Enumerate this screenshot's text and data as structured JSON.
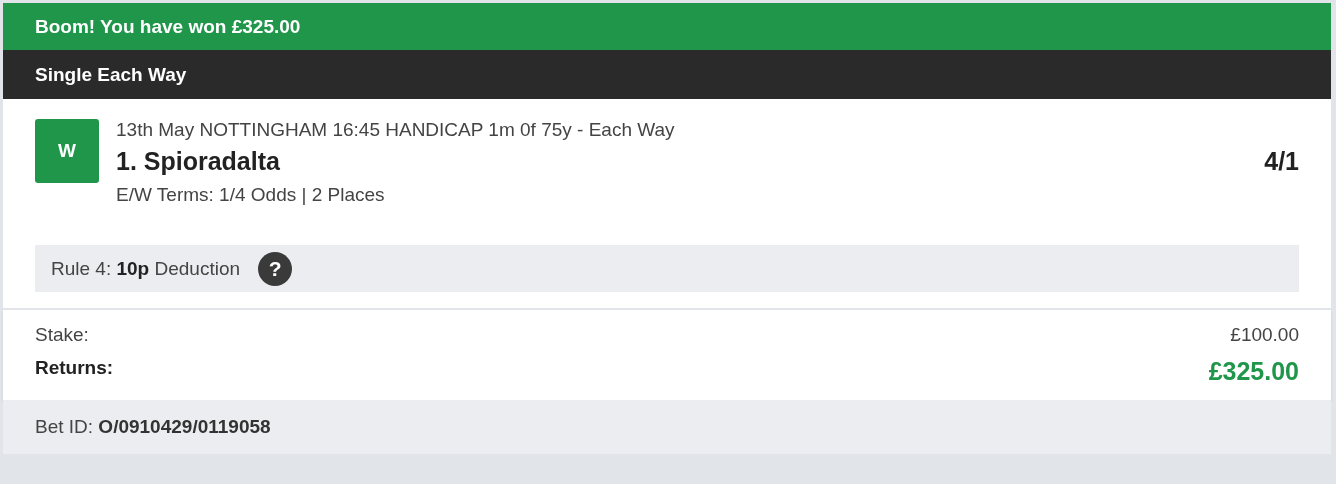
{
  "banner": {
    "text": "Boom! You have won £325.00"
  },
  "bet_type": "Single Each Way",
  "selection": {
    "result": "W",
    "event": "13th May NOTTINGHAM 16:45 HANDICAP 1m 0f 75y - Each Way",
    "runner": "1. Spioradalta",
    "odds": "4/1",
    "terms": "E/W Terms: 1/4 Odds | 2 Places"
  },
  "rule4": {
    "text": "Rule 4: **10p** Deduction",
    "help_icon": "?"
  },
  "totals": [
    {
      "label": "Stake:",
      "value": "£100.00",
      "kind": "plain"
    },
    {
      "label": "Returns:",
      "value": "£325.00",
      "kind": "highlight"
    }
  ],
  "bet_id": "Bet ID: **O/0910429/0119058**"
}
